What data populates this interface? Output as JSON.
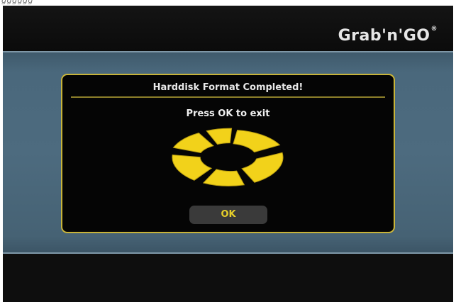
{
  "header": {
    "brand_name": "Grab'n'GO",
    "brand_mark": "®"
  },
  "dialog": {
    "title": "Harddisk Format Completed!",
    "message": "Press OK to exit",
    "ok_label": "OK",
    "progress_icon": "circular-segment-spinner-icon"
  },
  "colors": {
    "dialog_border": "#c8b43a",
    "spinner": "#f2d21a",
    "ok_text": "#e6cf2a",
    "band": "#4d6b7f"
  }
}
